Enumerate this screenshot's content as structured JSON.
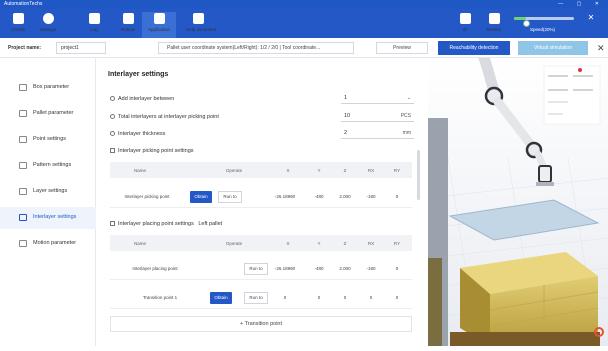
{
  "window": {
    "title": "AutomationTechs"
  },
  "toolbar": {
    "items": [
      {
        "label": "CRISB",
        "icon": "cursor-icon"
      },
      {
        "label": "Settings",
        "icon": "gear-icon"
      },
      {
        "label": "Log",
        "icon": "log-icon"
      },
      {
        "label": "Robots",
        "icon": "robot-icon"
      },
      {
        "label": "Application",
        "icon": "app-icon"
      },
      {
        "label": "Help document",
        "icon": "help-icon"
      }
    ],
    "right_items": [
      {
        "label": "IO",
        "icon": "io-icon"
      },
      {
        "label": "Monitor",
        "icon": "monitor-icon"
      }
    ],
    "speed_label": "Speed(20%)",
    "speed_fraction": 0.2
  },
  "project": {
    "name_label": "Project name:",
    "name_value": "project1",
    "coord_text": "Pallet user coordinate system(Left/Right): 1/2 / 2/0 | Tool coordinate...",
    "preview_label": "Preview",
    "reach_label": "Reachability detection",
    "virtual_label": "Virtual simulation"
  },
  "sidebar": {
    "items": [
      {
        "label": "Box parameter",
        "icon": "box-icon",
        "active": false
      },
      {
        "label": "Pallet parameter",
        "icon": "pallet-icon",
        "active": false
      },
      {
        "label": "Point settings",
        "icon": "point-icon",
        "active": false
      },
      {
        "label": "Pattern settings",
        "icon": "pattern-icon",
        "active": false
      },
      {
        "label": "Layer settings",
        "icon": "layer-icon",
        "active": false
      },
      {
        "label": "Interlayer settings",
        "icon": "interlayer-icon",
        "active": true
      },
      {
        "label": "Motion parameter",
        "icon": "motion-icon",
        "active": false
      }
    ]
  },
  "interlayer": {
    "title": "Interlayer settings",
    "add_between_label": "Add interlayer between",
    "add_between_value": "1",
    "total_label": "Total interlayers at interlayer picking point",
    "total_value": "10",
    "total_unit": "PCS",
    "thickness_label": "Interlayer thickness",
    "thickness_value": "2",
    "thickness_unit": "mm",
    "picking_section": "Interlayer picking point settings",
    "picking_headers": [
      "Name",
      "Operate",
      "X",
      "Y",
      "Z",
      "RX",
      "RY"
    ],
    "picking_row": {
      "name": "Interlayer picking point",
      "obtain": "Obtain",
      "runto": "Run to",
      "x": "-26.18990",
      "y": "-480",
      "z": "2.000",
      "rx": "-180",
      "ry": "0"
    },
    "placing_section": "Interlayer placing point settings",
    "placing_side": "Left pallet",
    "placing_headers": [
      "Name",
      "Operate",
      "X",
      "Y",
      "Z",
      "RX",
      "RY"
    ],
    "placing_row": {
      "name": "Interlayer placing point",
      "runto": "Run to",
      "x": "-26.18990",
      "y": "-480",
      "z": "2.000",
      "rx": "-180",
      "ry": "0"
    },
    "transition_row": {
      "name": "Transition point 1",
      "obtain": "Obtain",
      "runto": "Run to",
      "x": "0",
      "y": "0",
      "z": "0",
      "rx": "0",
      "ry": "0"
    },
    "add_transition": "+ Transition point"
  }
}
